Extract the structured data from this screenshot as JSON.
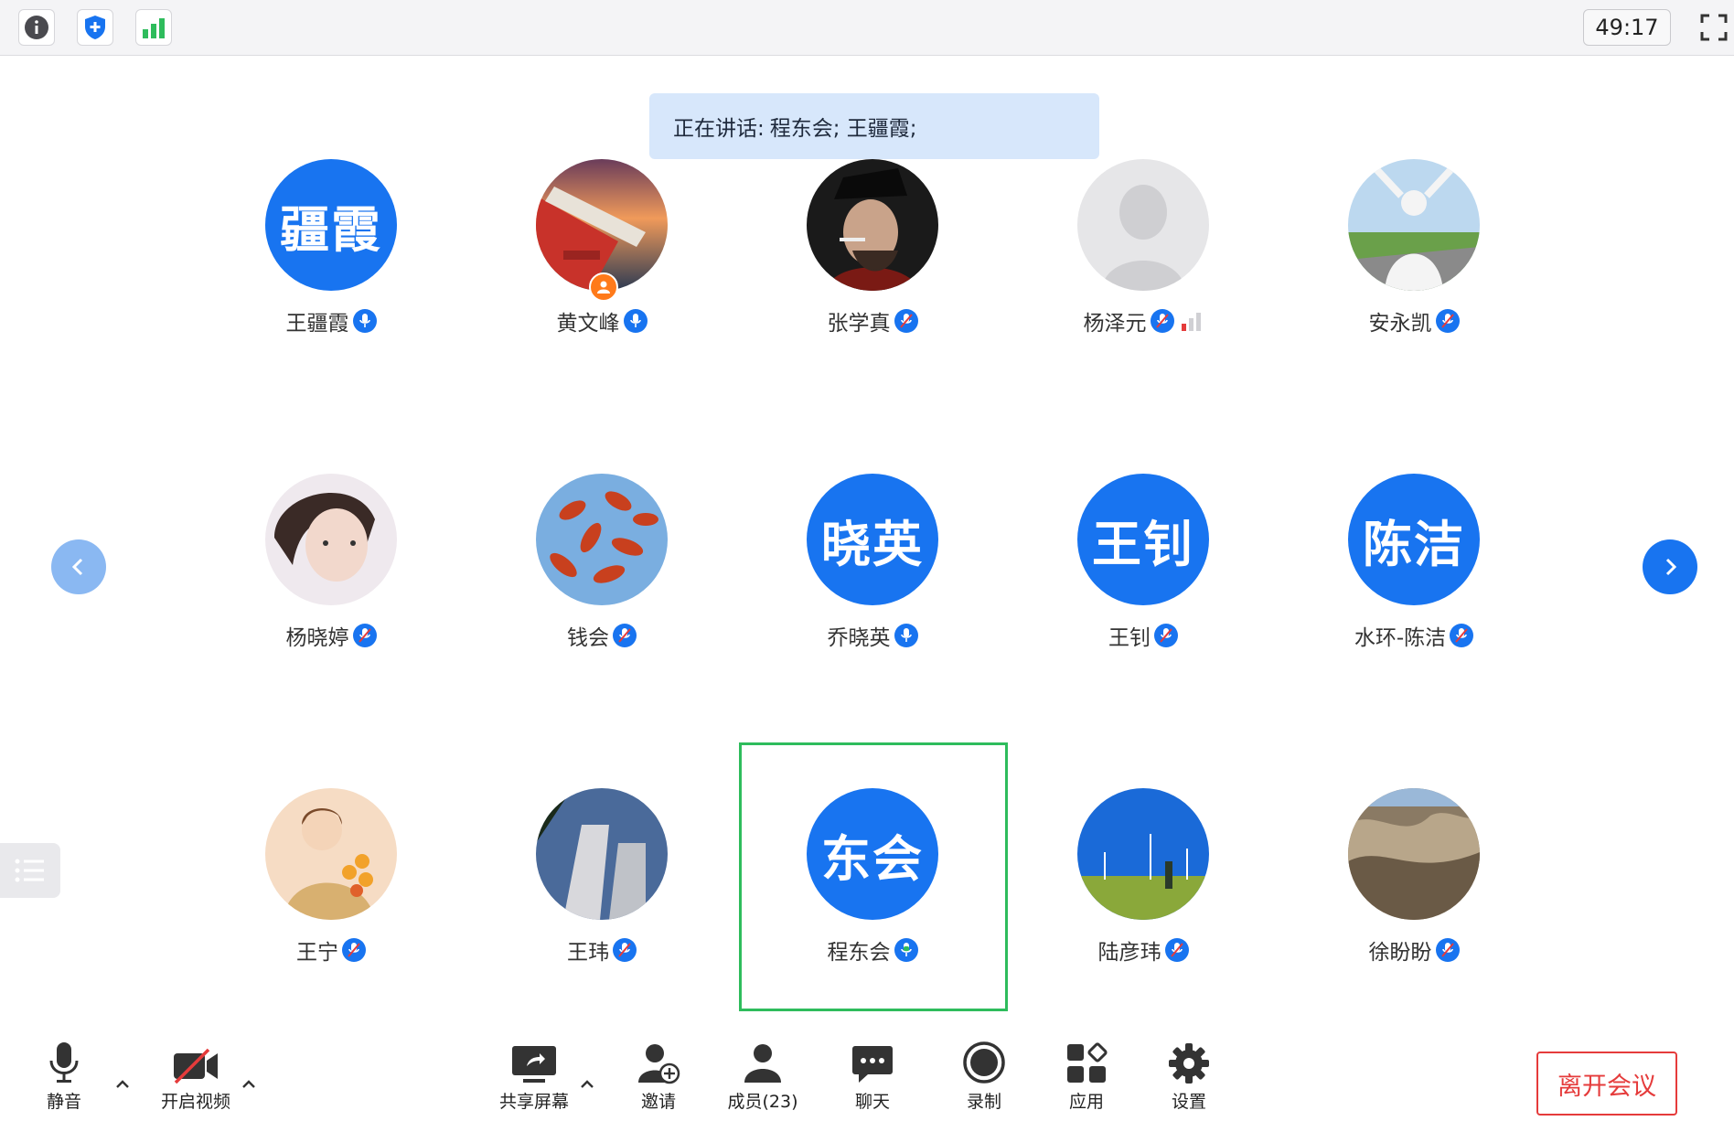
{
  "topbar": {
    "timer": "49:17",
    "icons": [
      "info-icon",
      "shield-icon",
      "signal-icon",
      "fullscreen-icon"
    ]
  },
  "speaking": {
    "label": "正在讲话:",
    "names": "程东会; 王疆霞;"
  },
  "participants": [
    {
      "name": "王疆霞",
      "avatar_text": "疆霞",
      "avatar": "text"
    },
    {
      "name": "黄文峰",
      "avatar": "photo-ship",
      "host": true
    },
    {
      "name": "张学真",
      "avatar": "photo-man"
    },
    {
      "name": "杨泽元",
      "avatar": "default-person",
      "signal": "weak"
    },
    {
      "name": "安永凯",
      "avatar": "photo-field"
    },
    {
      "name": "杨晓婷",
      "avatar": "photo-girl"
    },
    {
      "name": "钱会",
      "avatar": "photo-leaves"
    },
    {
      "name": "乔晓英",
      "avatar_text": "晓英",
      "avatar": "text"
    },
    {
      "name": "王钊",
      "avatar_text": "王钊",
      "avatar": "text"
    },
    {
      "name": "水环-陈洁",
      "avatar_text": "陈洁",
      "avatar": "text"
    },
    {
      "name": "王宁",
      "avatar": "illustration-flowers"
    },
    {
      "name": "王玮",
      "avatar": "photo-buildings"
    },
    {
      "name": "程东会",
      "avatar_text": "东会",
      "avatar": "text",
      "speaking": true
    },
    {
      "name": "陆彦玮",
      "avatar": "photo-windfarm"
    },
    {
      "name": "徐盼盼",
      "avatar": "photo-loess"
    }
  ],
  "toolbar": {
    "mute": "静音",
    "video": "开启视频",
    "share": "共享屏幕",
    "invite": "邀请",
    "members": "成员(23)",
    "chat": "聊天",
    "record": "录制",
    "apps": "应用",
    "settings": "设置",
    "leave": "离开会议"
  },
  "colors": {
    "accent": "#1874f0",
    "active_frame": "#2ebc5c",
    "leave": "#e53b3b",
    "banner": "#d7e7fb"
  }
}
